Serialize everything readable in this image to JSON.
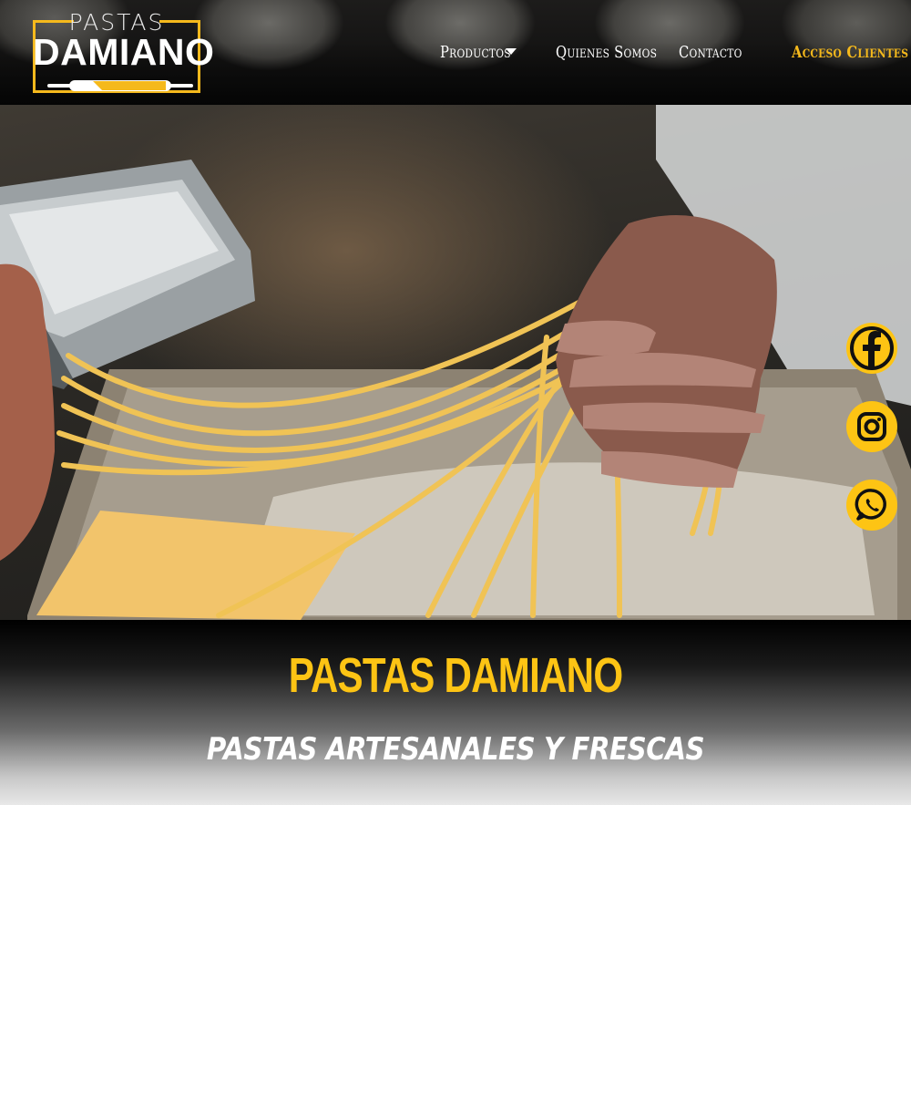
{
  "brand": {
    "logo_top": "PASTAS",
    "logo_main": "DAMIANO"
  },
  "nav": {
    "items": [
      {
        "label": "Productos",
        "has_dropdown": true
      },
      {
        "label": "Quienes Somos"
      },
      {
        "label": "Contacto"
      },
      {
        "label": "Acceso Clientes",
        "highlight": true
      }
    ]
  },
  "social": {
    "items": [
      {
        "icon": "facebook-icon"
      },
      {
        "icon": "instagram-icon"
      },
      {
        "icon": "whatsapp-icon"
      }
    ]
  },
  "banner": {
    "title": "PASTAS DAMIANO",
    "subtitle": "PASTAS ARTESANALES Y FRESCAS"
  },
  "colors": {
    "accent": "#fdc414",
    "header_bg": "#111111",
    "text_light": "#ffffff"
  }
}
